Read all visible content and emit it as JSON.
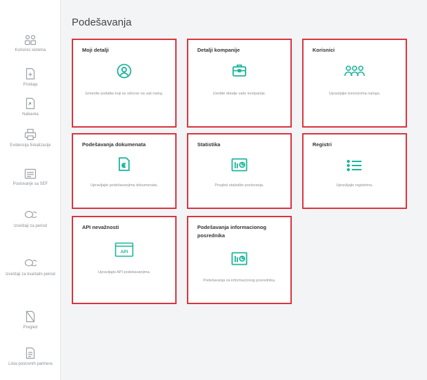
{
  "colors": {
    "accent": "#1bb59a",
    "highlight_border": "#d9343e",
    "muted_text": "#8a8f96"
  },
  "sidebar": {
    "items": [
      {
        "label": "Korisnici sistema",
        "icon": "users-icon"
      },
      {
        "label": "Prodaja",
        "icon": "document-plus-icon"
      },
      {
        "label": "Nabavka",
        "icon": "document-arrow-icon"
      },
      {
        "label": "Evidencija fiskalizacije",
        "icon": "printer-icon"
      },
      {
        "label": "Poslovanje sa SEF",
        "icon": "invoice-icon"
      },
      {
        "label": "Izveštaji za period",
        "icon": "chat-bubbles-icon"
      },
      {
        "label": "Izveštaji za kvartalni period",
        "icon": "chat-bubbles-icon"
      },
      {
        "label": "Pregled",
        "icon": "document-slash-icon"
      },
      {
        "label": "Lista poslovnih partnera",
        "icon": "document-list-icon"
      }
    ]
  },
  "page_title": "Podešavanja",
  "cards": [
    {
      "title": "Moji detalji",
      "icon": "user-circle-icon",
      "desc": "Izmenite podatke koji se odnose na vaš nalog."
    },
    {
      "title": "Detalji kompanije",
      "icon": "briefcase-icon",
      "desc": "Uredite detalje vaše kompanije."
    },
    {
      "title": "Korisnici",
      "icon": "users-group-icon",
      "desc": "Upravljajte korisnicima naloga."
    },
    {
      "title": "Podešavanja dokumenata",
      "icon": "document-euro-icon",
      "desc": "Upravljajte podešavanjima dokumenata."
    },
    {
      "title": "Statistika",
      "icon": "chart-window-icon",
      "desc": "Pregled statistike poslovanja."
    },
    {
      "title": "Registri",
      "icon": "list-icon",
      "desc": "Upravljajte registrima."
    },
    {
      "title": "API nevažnosti",
      "icon": "api-window-icon",
      "desc": "Upravljajte API podešavanjima."
    },
    {
      "title": "Podešavanja informacionog posrednika",
      "icon": "chart-window-icon",
      "desc": "Podešavanja za informacionog posrednika."
    }
  ]
}
